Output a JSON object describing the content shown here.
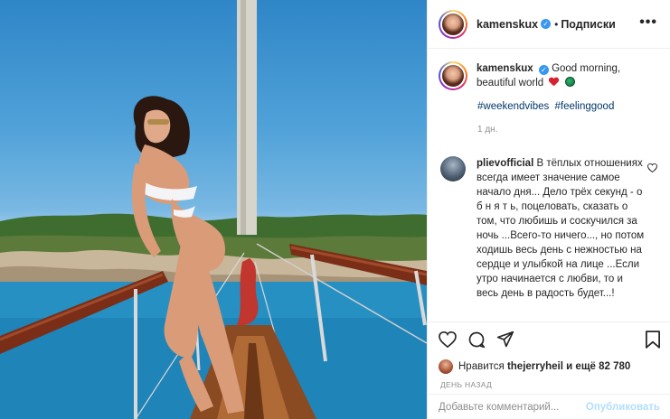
{
  "post": {
    "username": "kamenskux",
    "verified_mark": "✓",
    "dot": "•",
    "follow_label": "Подписки",
    "more_label": "•••"
  },
  "caption": {
    "username": "kamenskux",
    "text": "Good morning,",
    "text_line2": "beautiful world",
    "emojis": [
      "red-heart",
      "green-circle"
    ],
    "hashtags": [
      "#weekendvibes",
      "#feelinggood"
    ],
    "age": "1 дн."
  },
  "comment": {
    "username": "plievofficial",
    "text": "В тёплых отношениях всегда имеет значение самое начало дня... Дело трёх секунд - о б н я т ь, поцеловать, сказать о том, что любишь и соскучился за ночь ...Всего-то ничего..., но потом ходишь весь день с нежностью на сердце и улыбкой на лице ...Если утро начинается с любви, то и весь день в радость будет...!"
  },
  "likes": {
    "prefix": "Нравится",
    "user": "thejerryheil",
    "suffix": "и ещё 82 780"
  },
  "timestamp": "ДЕНЬ НАЗАД",
  "add_comment": {
    "placeholder": "Добавьте комментарий...",
    "post_label": "Опубликовать"
  },
  "colors": {
    "link": "#00376b",
    "verified": "#3897f0",
    "post_disabled": "#b2dffc",
    "muted": "#8e8e8e"
  },
  "icons": [
    "heart-icon",
    "comment-icon",
    "share-icon",
    "bookmark-icon",
    "more-icon",
    "verified-icon",
    "comment-like-icon"
  ]
}
